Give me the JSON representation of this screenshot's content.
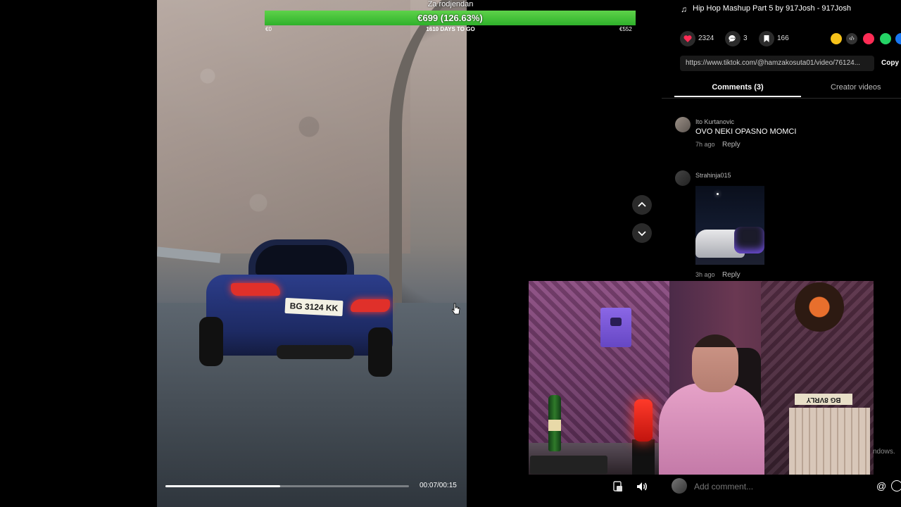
{
  "goal": {
    "title": "Za rodjendan",
    "amount": "€699 (126.63%)",
    "fill_fraction": 1.0,
    "start": "€0",
    "days_to_go": "1610 DAYS TO GO",
    "target": "€552"
  },
  "video": {
    "plate": "BG 3124 KK",
    "time": "00:07/00:15",
    "progress_fraction": 0.47
  },
  "music": {
    "icon": "music-note-icon",
    "title": "Hip Hop Mashup Part 5 by 917Josh - 917Josh"
  },
  "stats": {
    "likes": "2324",
    "comments": "3",
    "saves": "166"
  },
  "share": {
    "url": "https://www.tiktok.com/@hamzakosuta01/video/76124...",
    "copy_label": "Copy",
    "embed_label": "‹/›"
  },
  "tabs": {
    "comments": "Comments (3)",
    "creator": "Creator videos"
  },
  "comments": [
    {
      "user": "Ito Kurtanovic",
      "text": "OVO NEKI OPASNO MOMCI",
      "time": "7h ago",
      "reply": "Reply"
    },
    {
      "user": "Strahinja015",
      "text": "",
      "time": "3h ago",
      "reply": "Reply"
    }
  ],
  "webcam": {
    "plate_sign": "BG 8VRLY"
  },
  "add_comment": {
    "placeholder": "Add comment...",
    "mention": "@"
  },
  "os_watermark": "ndows.",
  "colors": {
    "goal_fill": "#2fb12b",
    "like_heart": "#fe2c55",
    "background": "#000000"
  }
}
